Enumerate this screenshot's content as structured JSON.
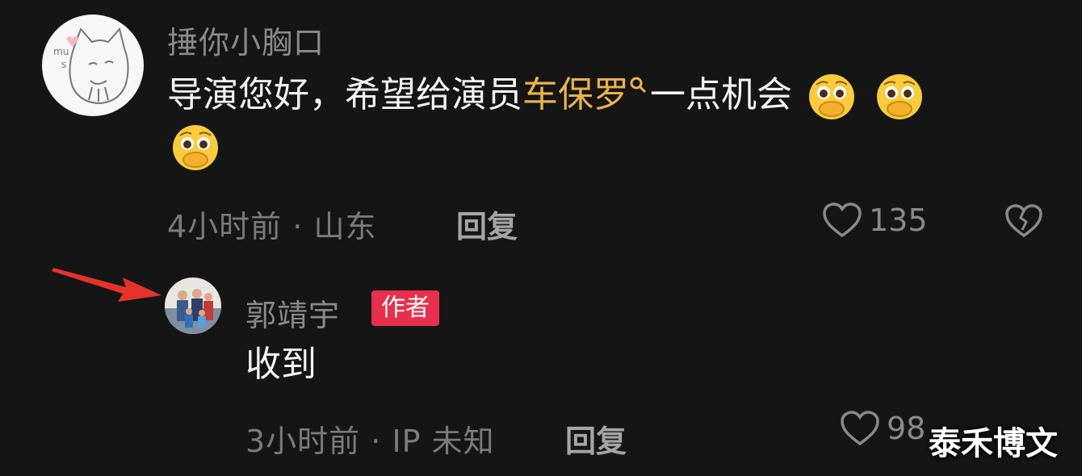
{
  "comments": [
    {
      "username": "捶你小胸口",
      "text_before": "导演您好，希望给演员",
      "highlight": "车保罗",
      "text_after": "一点机会",
      "emoji_count": 3,
      "time": "4小时前",
      "location": "山东",
      "reply_label": "回复",
      "likes": "135"
    },
    {
      "username": "郭靖宇",
      "badge": "作者",
      "text": "收到",
      "time": "3小时前",
      "location": "IP 未知",
      "reply_label": "回复",
      "likes": "98"
    }
  ],
  "watermark": "泰禾博文",
  "colors": {
    "background": "#151515",
    "highlight": "#e9b44c",
    "badge": "#e8304d",
    "arrow": "#e5332a"
  },
  "icons": [
    "search-icon",
    "heart-icon",
    "broken-heart-icon",
    "pleading-emoji-icon",
    "arrow-icon"
  ]
}
